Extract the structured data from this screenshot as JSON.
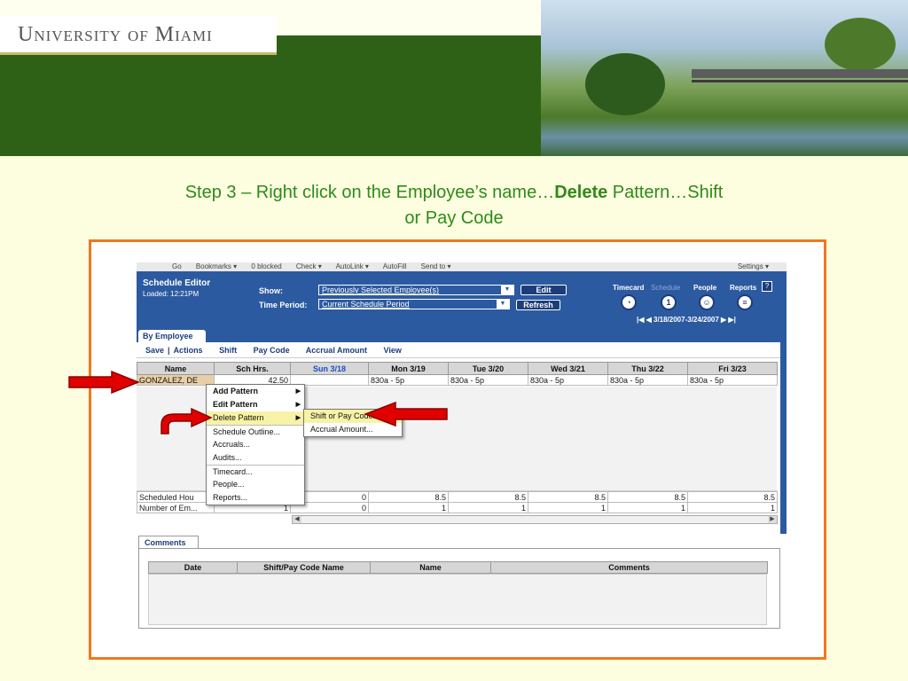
{
  "header": {
    "logo_text": "University of Miami"
  },
  "slide": {
    "title_pre": "Step 3 – Right click on the Employee’s name…",
    "title_bold": "Delete",
    "title_post": " Pattern…Shift",
    "title_line2": "or Pay Code"
  },
  "browser_toolbar": {
    "items": [
      "Go",
      "Bookmarks ▾",
      "0 blocked",
      "Check ▾",
      "AutoLink ▾",
      "AutoFill",
      "Send to ▾"
    ],
    "settings": "Settings ▾"
  },
  "editor": {
    "title": "Schedule Editor",
    "loaded": "Loaded: 12:21PM",
    "show_label": "Show:",
    "show_value": "Previously Selected Employee(s)",
    "time_period_label": "Time Period:",
    "time_period_value": "Current Schedule Period",
    "edit_button": "Edit",
    "refresh_button": "Refresh",
    "nav": {
      "timecard": "Timecard",
      "schedule": "Schedule",
      "people": "People",
      "reports": "Reports"
    },
    "help": "?",
    "date_range": "|◀  ◀  3/18/2007-3/24/2007  ▶  ▶|"
  },
  "tabs": {
    "by_employee": "By Employee",
    "comments": "Comments"
  },
  "toolbar": {
    "save": "Save",
    "divider": "|",
    "actions": "Actions",
    "shift": "Shift",
    "pay_code": "Pay Code",
    "accrual_amount": "Accrual Amount",
    "view": "View"
  },
  "grid": {
    "columns": [
      "Name",
      "Sch Hrs.",
      "Sun 3/18",
      "Mon 3/19",
      "Tue 3/20",
      "Wed 3/21",
      "Thu 3/22",
      "Fri 3/23"
    ],
    "row": {
      "name": "GONZALEZ, DE",
      "sch_hrs": "42.50",
      "sun": "",
      "mon": "830a - 5p",
      "tue": "830a - 5p",
      "wed": "830a - 5p",
      "thu": "830a - 5p",
      "fri": "830a - 5p"
    },
    "totals": [
      {
        "label": "Scheduled Hou",
        "values": [
          "",
          "0",
          "8.5",
          "8.5",
          "8.5",
          "8.5",
          "8.5"
        ]
      },
      {
        "label": "Number of Em...",
        "values": [
          "1",
          "0",
          "1",
          "1",
          "1",
          "1",
          "1"
        ]
      }
    ]
  },
  "comments_table": {
    "columns": [
      "Date",
      "Shift/Pay Code Name",
      "Name",
      "Comments"
    ]
  },
  "context_menu": {
    "items": [
      {
        "label": "Add Pattern",
        "bold": true,
        "submenu": true
      },
      {
        "label": "Edit Pattern",
        "bold": true,
        "submenu": true
      },
      {
        "label": "Delete Pattern",
        "bold": false,
        "submenu": true,
        "highlighted": true
      },
      {
        "label": "Schedule Outline...",
        "separator": true
      },
      {
        "label": "Accruals..."
      },
      {
        "label": "Audits..."
      },
      {
        "label": "Timecard...",
        "separator": true
      },
      {
        "label": "People..."
      },
      {
        "label": "Reports..."
      }
    ],
    "submenu_items": [
      {
        "label": "Shift or Pay Code...",
        "highlighted": true
      },
      {
        "label": "Accrual Amount..."
      }
    ]
  },
  "colors": {
    "title_green": "#2e8b17",
    "frame_orange": "#f07820",
    "app_blue": "#2c5aa0",
    "arrow_red": "#e00000",
    "menu_highlight": "#f7f3a6"
  }
}
